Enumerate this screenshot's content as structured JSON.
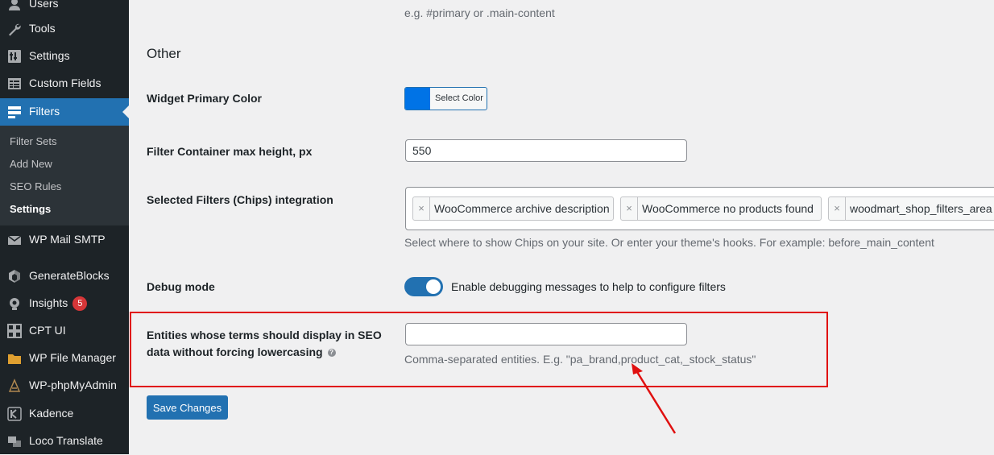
{
  "sidebar": {
    "items": [
      {
        "label": "Users",
        "icon": "users-icon"
      },
      {
        "label": "Tools",
        "icon": "wrench-icon"
      },
      {
        "label": "Settings",
        "icon": "settings-icon"
      },
      {
        "label": "Custom Fields",
        "icon": "custom-fields-icon"
      },
      {
        "label": "Filters",
        "icon": "filter-icon"
      },
      {
        "label": "WP Mail SMTP",
        "icon": "mail-icon"
      },
      {
        "label": "GenerateBlocks",
        "icon": "generateblocks-icon"
      },
      {
        "label": "Insights",
        "icon": "insights-icon",
        "badge": "5"
      },
      {
        "label": "CPT UI",
        "icon": "cpt-ui-icon"
      },
      {
        "label": "WP File Manager",
        "icon": "file-manager-icon"
      },
      {
        "label": "WP-phpMyAdmin",
        "icon": "phpmyadmin-icon"
      },
      {
        "label": "Kadence",
        "icon": "kadence-icon"
      },
      {
        "label": "Loco Translate",
        "icon": "translate-icon"
      }
    ],
    "submenu": [
      "Filter Sets",
      "Add New",
      "SEO Rules",
      "Settings"
    ]
  },
  "main": {
    "top_hint": "e.g. #primary or .main-content",
    "section_title": "Other",
    "widget_color": {
      "label": "Widget Primary Color",
      "button": "Select Color",
      "value": "#0073e6"
    },
    "max_height": {
      "label": "Filter Container max height, px",
      "value": "550"
    },
    "chips": {
      "label": "Selected Filters (Chips) integration",
      "items": [
        "WooCommerce archive description",
        "WooCommerce no products found",
        "woodmart_shop_filters_area"
      ],
      "hint": "Select where to show Chips on your site. Or enter your theme's hooks. For example: before_main_content"
    },
    "debug": {
      "label": "Debug mode",
      "text": "Enable debugging messages to help to configure filters",
      "enabled": true
    },
    "entities": {
      "label_line1": "Entities whose terms should display in SEO",
      "label_line2": "data without forcing lowercasing",
      "value": "",
      "hint": "Comma-separated entities. E.g. \"pa_brand,product_cat,_stock_status\""
    },
    "save_label": "Save Changes"
  },
  "colors": {
    "accent": "#2271b1",
    "highlight": "#e01010",
    "sidebar": "#1d2327"
  }
}
